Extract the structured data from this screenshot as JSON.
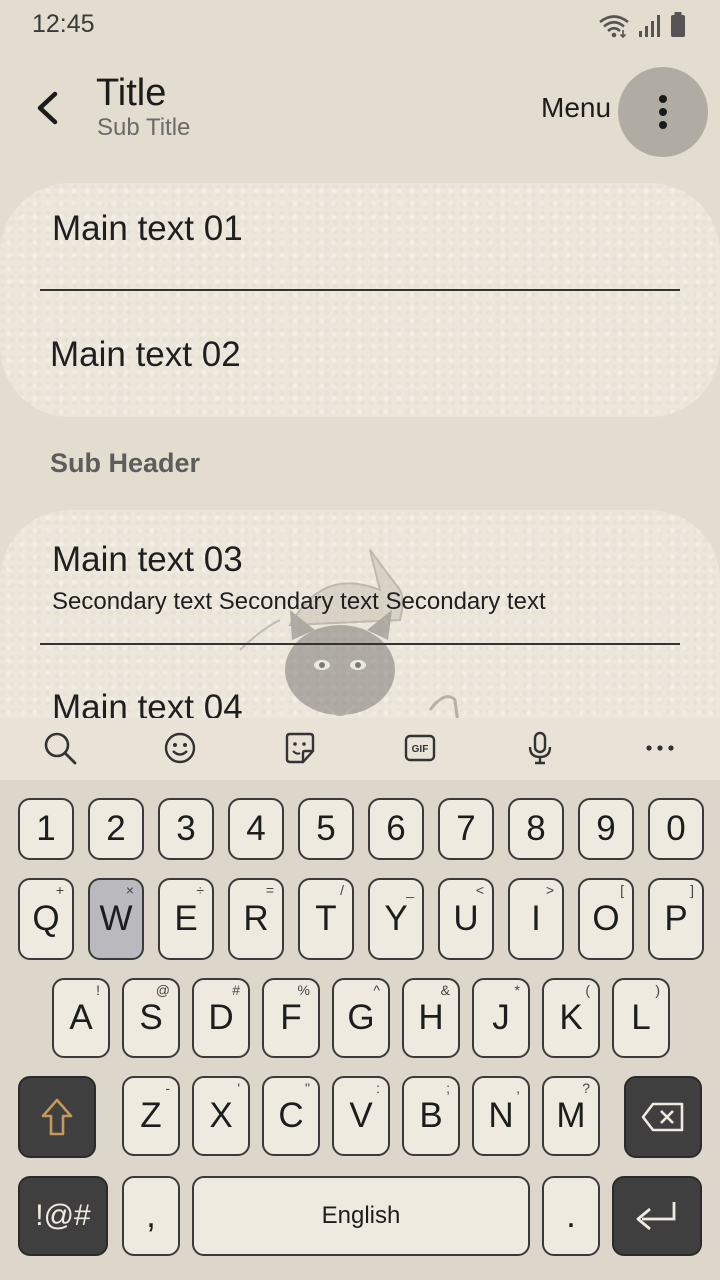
{
  "status": {
    "time": "12:45"
  },
  "app_bar": {
    "title": "Title",
    "subtitle": "Sub Title",
    "menu_label": "Menu"
  },
  "list": {
    "item1": "Main text 01",
    "item2": "Main text 02",
    "sub_header": "Sub Header",
    "item3": "Main text 03",
    "item3_secondary": "Secondary text Secondary text Secondary text",
    "item4": "Main text 04"
  },
  "keyboard": {
    "numbers": [
      "1",
      "2",
      "3",
      "4",
      "5",
      "6",
      "7",
      "8",
      "9",
      "0"
    ],
    "row1": [
      {
        "key": "Q",
        "sup": "+"
      },
      {
        "key": "W",
        "sup": "×"
      },
      {
        "key": "E",
        "sup": "÷"
      },
      {
        "key": "R",
        "sup": "="
      },
      {
        "key": "T",
        "sup": "/"
      },
      {
        "key": "Y",
        "sup": "_"
      },
      {
        "key": "U",
        "sup": "<"
      },
      {
        "key": "I",
        "sup": ">"
      },
      {
        "key": "O",
        "sup": "["
      },
      {
        "key": "P",
        "sup": "]"
      }
    ],
    "row2": [
      {
        "key": "A",
        "sup": "!"
      },
      {
        "key": "S",
        "sup": "@"
      },
      {
        "key": "D",
        "sup": "#"
      },
      {
        "key": "F",
        "sup": "%"
      },
      {
        "key": "G",
        "sup": "^"
      },
      {
        "key": "H",
        "sup": "&"
      },
      {
        "key": "J",
        "sup": "*"
      },
      {
        "key": "K",
        "sup": "("
      },
      {
        "key": "L",
        "sup": ")"
      }
    ],
    "row3": [
      {
        "key": "Z",
        "sup": "-"
      },
      {
        "key": "X",
        "sup": "'"
      },
      {
        "key": "C",
        "sup": "\""
      },
      {
        "key": "V",
        "sup": ":"
      },
      {
        "key": "B",
        "sup": ";"
      },
      {
        "key": "N",
        "sup": ","
      },
      {
        "key": "M",
        "sup": "?"
      }
    ],
    "symbols_label": "!@#",
    "comma": ",",
    "space_label": "English",
    "period": ".",
    "pressed_key": "W"
  }
}
